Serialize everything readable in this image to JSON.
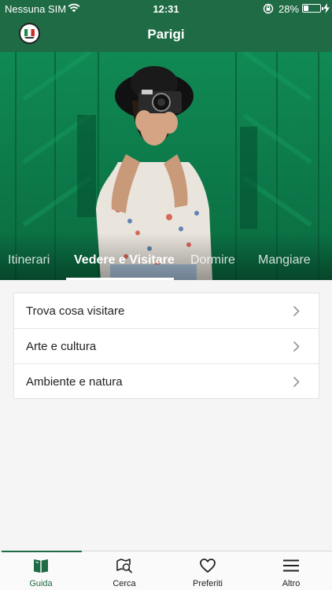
{
  "status_bar": {
    "carrier": "Nessuna SIM",
    "time": "12:31",
    "battery_percent": "28%",
    "battery_level": 0.28
  },
  "header": {
    "title": "Parigi",
    "logo_icon": "italy-flag-logo-icon"
  },
  "hero": {
    "tabs": [
      {
        "label": "Itinerari",
        "active": false
      },
      {
        "label": "Vedere e Visitare",
        "active": true
      },
      {
        "label": "Dormire",
        "active": false
      },
      {
        "label": "Mangiare",
        "active": false
      }
    ]
  },
  "menu": {
    "items": [
      {
        "label": "Trova cosa visitare",
        "icon": "chevron-right-icon"
      },
      {
        "label": "Arte e cultura",
        "icon": "chevron-right-icon"
      },
      {
        "label": "Ambiente e natura",
        "icon": "chevron-right-icon"
      }
    ]
  },
  "bottom_bar": {
    "items": [
      {
        "label": "Guida",
        "icon": "book-icon",
        "active": true
      },
      {
        "label": "Cerca",
        "icon": "search-map-icon",
        "active": false
      },
      {
        "label": "Preferiti",
        "icon": "heart-icon",
        "active": false
      },
      {
        "label": "Altro",
        "icon": "menu-icon",
        "active": false
      }
    ]
  },
  "colors": {
    "brand_green": "#1f6b45",
    "hero_green": "#0d7a4c",
    "background": "#f5f5f5"
  }
}
